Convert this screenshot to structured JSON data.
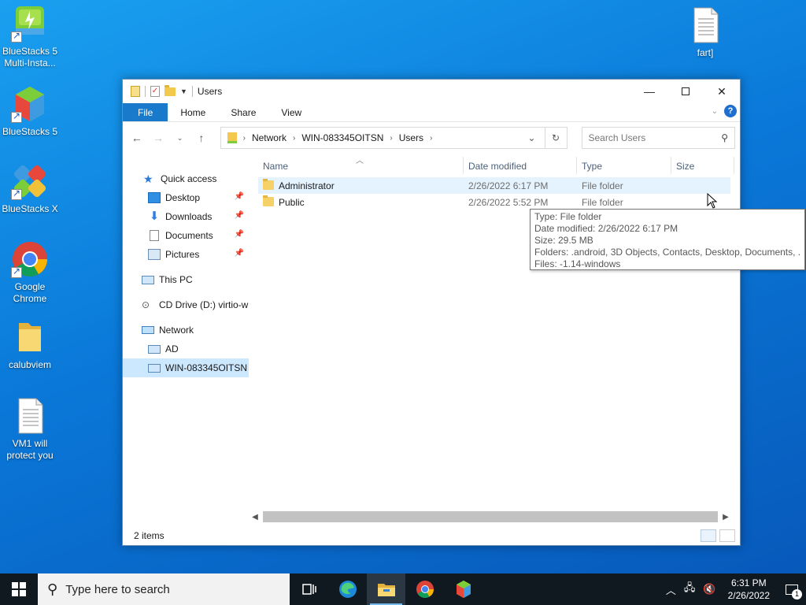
{
  "desktop": {
    "icons": [
      {
        "label": "BlueStacks 5 Multi-Insta..."
      },
      {
        "label": "BlueStacks 5"
      },
      {
        "label": "BlueStacks X"
      },
      {
        "label": "Google Chrome"
      },
      {
        "label": "calubviem"
      },
      {
        "label": "VM1 will protect you"
      },
      {
        "label": "fart]"
      }
    ]
  },
  "window": {
    "title": "Users",
    "ribbon": {
      "file": "File",
      "home": "Home",
      "share": "Share",
      "view": "View"
    },
    "address": {
      "crumbs": [
        "Network",
        "WIN-083345OITSN",
        "Users"
      ]
    },
    "search": {
      "placeholder": "Search Users"
    },
    "nav": {
      "quick_access": "Quick access",
      "desktop": "Desktop",
      "downloads": "Downloads",
      "documents": "Documents",
      "pictures": "Pictures",
      "this_pc": "This PC",
      "cd_drive": "CD Drive (D:) virtio-w",
      "network": "Network",
      "ad": "AD",
      "win_host": "WIN-083345OITSN"
    },
    "columns": {
      "name": "Name",
      "date": "Date modified",
      "type": "Type",
      "size": "Size"
    },
    "rows": [
      {
        "name": "Administrator",
        "date": "2/26/2022 6:17 PM",
        "type": "File folder"
      },
      {
        "name": "Public",
        "date": "2/26/2022 5:52 PM",
        "type": "File folder"
      }
    ],
    "status": "2 items"
  },
  "tooltip": {
    "line1": "Type: File folder",
    "line2": "Date modified: 2/26/2022 6:17 PM",
    "line3": "Size: 29.5 MB",
    "line4": "Folders: .android, 3D Objects, Contacts, Desktop, Documents, ...",
    "line5": "Files: -1.14-windows"
  },
  "taskbar": {
    "search_placeholder": "Type here to search",
    "time": "6:31 PM",
    "date": "2/26/2022",
    "notification_count": "1"
  }
}
